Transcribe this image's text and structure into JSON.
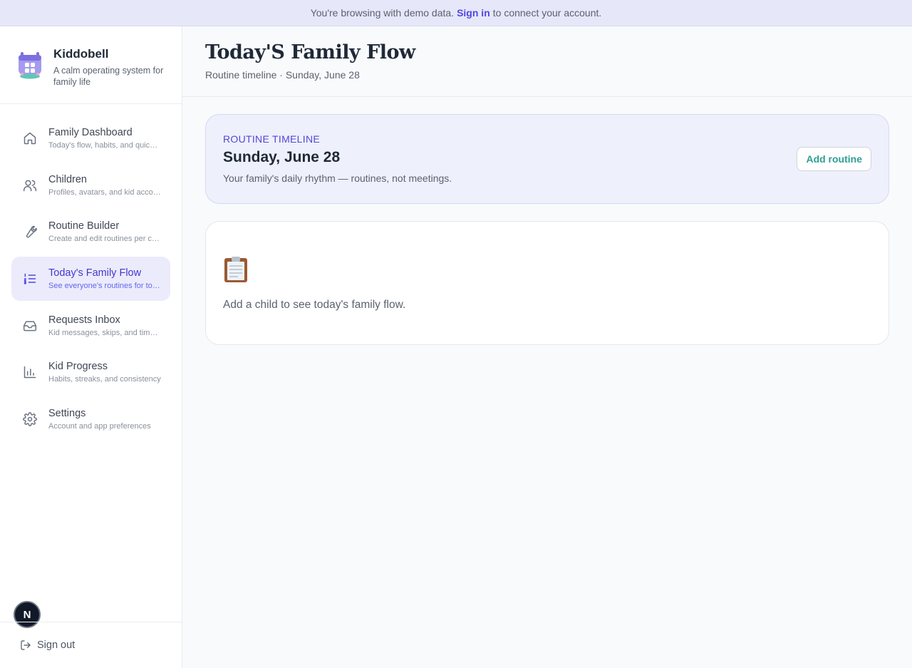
{
  "banner": {
    "text_before": "You're browsing with demo data.",
    "link": "Sign in",
    "text_after": "to connect your account."
  },
  "brand": {
    "name": "Kiddobell",
    "tagline": "A calm operating system for family life",
    "logo_icon": "calendar-icon"
  },
  "nav": [
    {
      "label": "Family Dashboard",
      "sub": "Today's flow, habits, and quick actions",
      "icon": "home-icon",
      "active": false
    },
    {
      "label": "Children",
      "sub": "Profiles, avatars, and kid accounts",
      "icon": "users-icon",
      "active": false
    },
    {
      "label": "Routine Builder",
      "sub": "Create and edit routines per child",
      "icon": "wrench-icon",
      "active": false
    },
    {
      "label": "Today's Family Flow",
      "sub": "See everyone's routines for today",
      "icon": "list-ordered-icon",
      "active": true
    },
    {
      "label": "Requests Inbox",
      "sub": "Kid messages, skips, and time requests",
      "icon": "inbox-icon",
      "active": false
    },
    {
      "label": "Kid Progress",
      "sub": "Habits, streaks, and consistency",
      "icon": "bar-chart-icon",
      "active": false
    },
    {
      "label": "Settings",
      "sub": "Account and app preferences",
      "icon": "gear-icon",
      "active": false
    }
  ],
  "user": {
    "initial": "N"
  },
  "footer": {
    "signout": "Sign out"
  },
  "header": {
    "title": "Today'S Family Flow",
    "subtitle": "Routine timeline · Sunday, June 28"
  },
  "hero": {
    "eyebrow": "ROUTINE TIMELINE",
    "date": "Sunday, June 28",
    "description": "Your family's daily rhythm — routines, not meetings.",
    "add_button": "Add routine"
  },
  "empty": {
    "icon": "clipboard-icon",
    "text": "Add a child to see today's family flow."
  },
  "colors": {
    "accent": "#4f46e5",
    "teal": "#2f9e94",
    "banner_bg": "#e6e7f8",
    "active_nav_bg": "#ebebfb"
  }
}
